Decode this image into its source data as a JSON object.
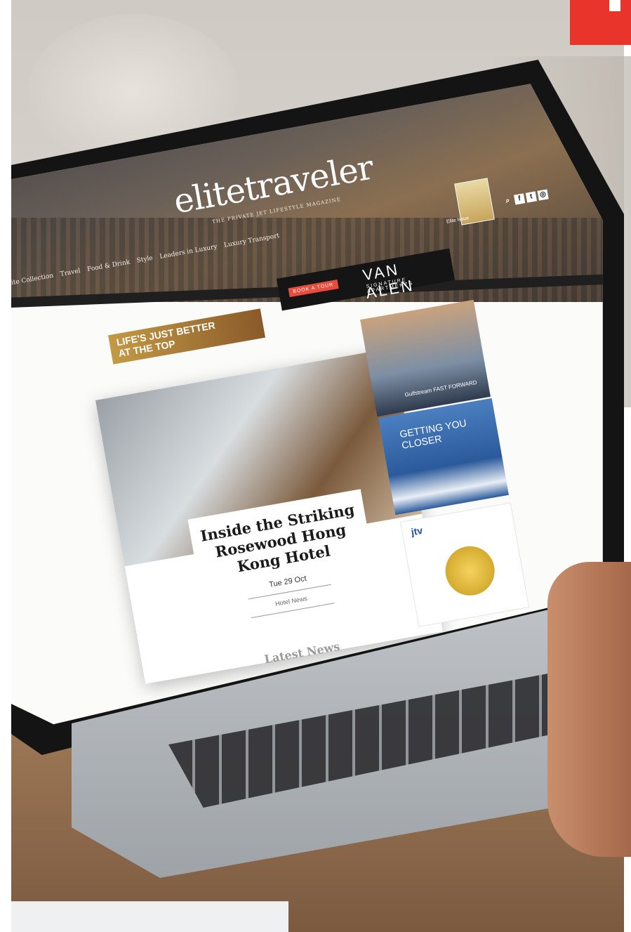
{
  "site": {
    "logo": "elitetraveler",
    "tagline": "THE PRIVATE JET LIFESTYLE MAGAZINE",
    "issue_label": "Elite Issue"
  },
  "nav": {
    "items": [
      "Elite Collection",
      "Travel",
      "Food & Drink",
      "Style",
      "Leaders in Luxury",
      "Luxury Transport"
    ]
  },
  "ads": {
    "van_alen": {
      "book": "BOOK A TOUR",
      "name": "VAN ALEN",
      "sub": "SIGNATURE APARTMENTS"
    },
    "life": {
      "line1": "LIFE'S JUST BETTER",
      "line2": "AT THE TOP"
    },
    "jet": {
      "text": "Gulfstream  FAST FORWARD"
    },
    "yacht": {
      "text": "GETTING YOU CLOSER"
    },
    "jtv": {
      "brand": "jtv"
    }
  },
  "feature": {
    "title": "Inside the Striking Rosewood Hong Kong Hotel",
    "date": "Tue 29 Oct",
    "category": "Hotel News"
  },
  "section_heading": "Latest News"
}
